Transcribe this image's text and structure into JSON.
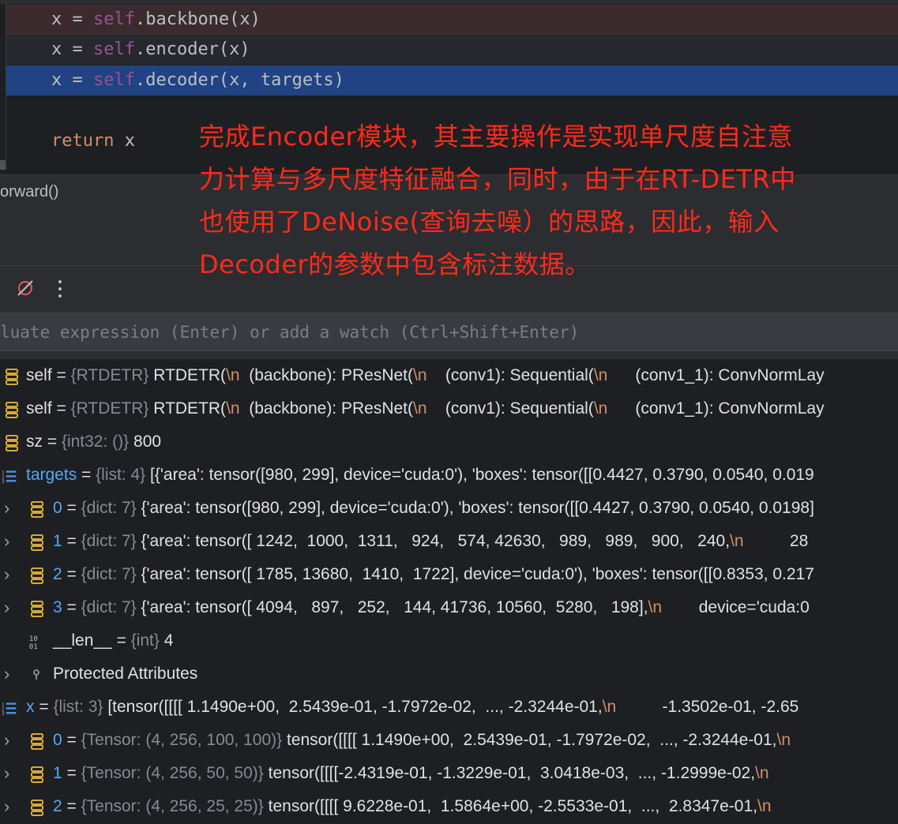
{
  "editor": {
    "lines": [
      {
        "pre": "x = ",
        "self": "self",
        "post": ".backbone(x)"
      },
      {
        "pre": "x = ",
        "self": "self",
        "post": ".encoder(x)"
      },
      {
        "pre": "x = ",
        "self": "self",
        "post": ".decoder(x, targets)"
      },
      {
        "ret": "return",
        "post": " x"
      }
    ],
    "breadcrumb": "orward()"
  },
  "annotation": {
    "lines": [
      "完成Encoder模块，其主要操作是实现单尺度自注意",
      "力计算与多尺度特征融合，同时，由于在RT-DETR中",
      "也使用了DeNoise(查询去噪）的思路，因此，输入",
      "Decoder的参数中包含标注数据。"
    ]
  },
  "toolbar": {
    "icons": [
      "mute-breakpoints-icon",
      "more-options-icon"
    ]
  },
  "evaluate": {
    "placeholder": "luate expression (Enter) or add a watch (Ctrl+Shift+Enter)"
  },
  "variables": [
    {
      "name": "self",
      "type": "{RTDETR}",
      "value": "RTDETR(\\n  (backbone): PResNet(\\n    (conv1): Sequential(\\n      (conv1_1): ConvNormLay"
    },
    {
      "name": "self",
      "type": "{RTDETR}",
      "value": "RTDETR(\\n  (backbone): PResNet(\\n    (conv1): Sequential(\\n      (conv1_1): ConvNormLay"
    },
    {
      "name": "sz",
      "type": "{int32: ()}",
      "value": "800"
    },
    {
      "name": "targets",
      "type": "{list: 4}",
      "value": "[{'area': tensor([980, 299], device='cuda:0'), 'boxes': tensor([[0.4427, 0.3790, 0.0540, 0.019"
    },
    {
      "name": "0",
      "type": "{dict: 7}",
      "value": "{'area': tensor([980, 299], device='cuda:0'), 'boxes': tensor([[0.4427, 0.3790, 0.0540, 0.0198]"
    },
    {
      "name": "1",
      "type": "{dict: 7}",
      "value": "{'area': tensor([ 1242,  1000,  1311,   924,   574, 42630,   989,   989,   900,   240,\\n          28"
    },
    {
      "name": "2",
      "type": "{dict: 7}",
      "value": "{'area': tensor([ 1785, 13680,  1410,  1722], device='cuda:0'), 'boxes': tensor([[0.8353, 0.217"
    },
    {
      "name": "3",
      "type": "{dict: 7}",
      "value": "{'area': tensor([ 4094,   897,   252,   144, 41736, 10560,  5280,   198],\\n        device='cuda:0"
    },
    {
      "name": "__len__",
      "type": "{int}",
      "value": "4"
    },
    {
      "name": "Protected Attributes",
      "type": "",
      "value": ""
    },
    {
      "name": "x",
      "type": "{list: 3}",
      "value": "[tensor([[[[ 1.1490e+00,  2.5439e-01, -1.7972e-02,  ..., -2.3244e-01,\\n          -1.3502e-01, -2.65"
    },
    {
      "name": "0",
      "type": "{Tensor: (4, 256, 100, 100)}",
      "value": "tensor([[[[ 1.1490e+00,  2.5439e-01, -1.7972e-02,  ..., -2.3244e-01,\\n"
    },
    {
      "name": "1",
      "type": "{Tensor: (4, 256, 50, 50)}",
      "value": "tensor([[[[-2.4319e-01, -1.3229e-01,  3.0418e-03,  ..., -1.2999e-02,\\n"
    },
    {
      "name": "2",
      "type": "{Tensor: (4, 256, 25, 25)}",
      "value": "tensor([[[[ 9.6228e-01,  1.5864e+00, -2.5533e-01,  ...,  2.8347e-01,\\n"
    }
  ],
  "colors": {
    "annotation": "#ff2a1a",
    "selection": "#214283",
    "breakpoint_line": "#3b2b2f",
    "blue_name": "#56a8f5",
    "orange_escape": "#cf8e6d"
  }
}
